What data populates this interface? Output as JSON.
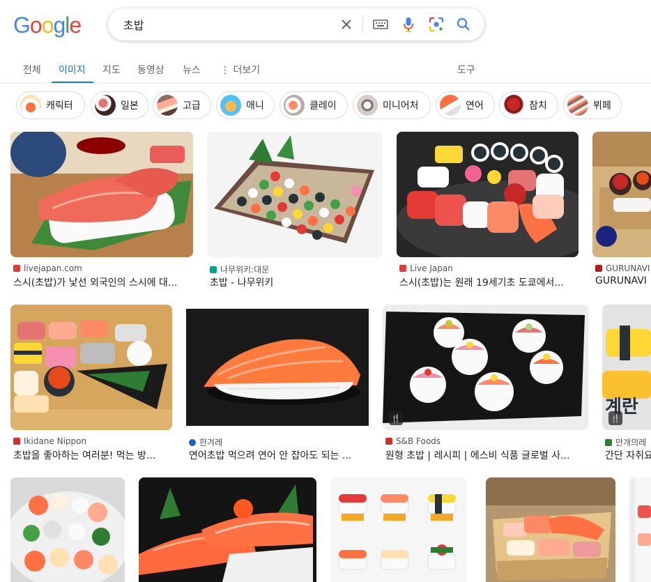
{
  "logo": {
    "letters": [
      "G",
      "o",
      "o",
      "g",
      "l",
      "e"
    ]
  },
  "search": {
    "query": "초밥"
  },
  "tabs": [
    {
      "label": "전체"
    },
    {
      "label": "이미지"
    },
    {
      "label": "지도"
    },
    {
      "label": "동영상"
    },
    {
      "label": "뉴스"
    },
    {
      "label": "⋮ 더보기"
    },
    {
      "label": "도구"
    }
  ],
  "chips": [
    {
      "label": "캐릭터"
    },
    {
      "label": "일본"
    },
    {
      "label": "고급"
    },
    {
      "label": "애니"
    },
    {
      "label": "클레이"
    },
    {
      "label": "미니어처"
    },
    {
      "label": "연어"
    },
    {
      "label": "참치"
    },
    {
      "label": "뷔페"
    }
  ],
  "results": [
    {
      "source": "livejapan.com",
      "title": "스시(초밥)가 낯선 외국인의 스시에 대..."
    },
    {
      "source": "나무위키:대문",
      "title": "초밥 - 나무위키"
    },
    {
      "source": "Live Japan",
      "title": "스시(초밥)는 원래 19세기초 도쿄에서..."
    },
    {
      "source": "GURUNAVI",
      "title": "GURUNAVI"
    },
    {
      "source": "Ikidane Nippon",
      "title": "초밥을 좋아하는 여러분! 먹는 방..."
    },
    {
      "source": "한겨레",
      "title": "연어초밥 먹으려 연어 안 잡아도 되는 ..."
    },
    {
      "source": "S&B Foods",
      "title": "원형 초밥 | 레시피 | 에스비 식품 글로벌 사..."
    },
    {
      "source": "만개의레",
      "title": "간단 자취요"
    }
  ],
  "colors": {
    "accent": "#1a73e8",
    "google_blue": "#4285f4",
    "google_red": "#ea4335",
    "google_yellow": "#fbbc05",
    "google_green": "#34a853"
  }
}
